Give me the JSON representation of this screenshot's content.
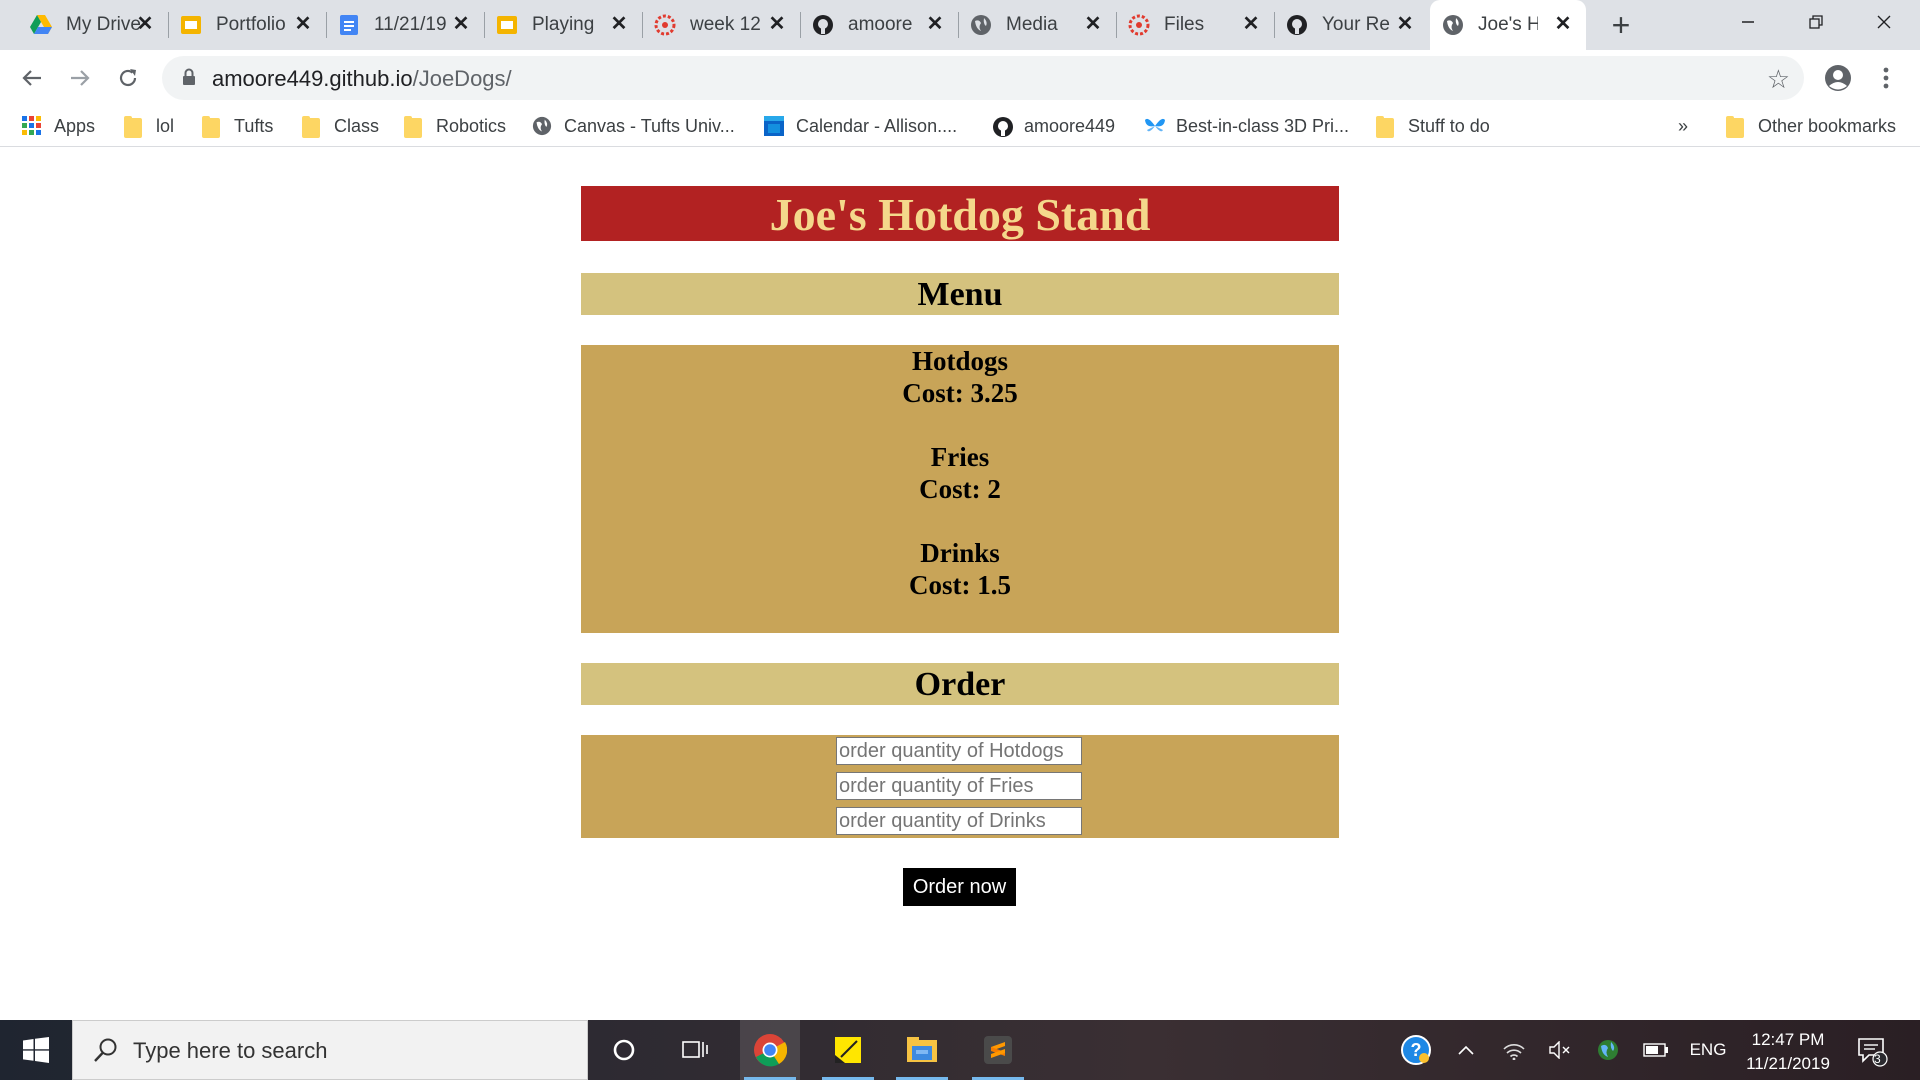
{
  "browser": {
    "tabs": [
      {
        "title": "My Drive",
        "favicon": "google-drive-icon"
      },
      {
        "title": "Portfolio",
        "favicon": "slides-icon"
      },
      {
        "title": "11/21/19",
        "favicon": "docs-icon"
      },
      {
        "title": "Playing",
        "favicon": "slides-icon"
      },
      {
        "title": "week 12",
        "favicon": "canvas-icon"
      },
      {
        "title": "amoore",
        "favicon": "github-icon"
      },
      {
        "title": "Media",
        "favicon": "globe-icon"
      },
      {
        "title": "Files",
        "favicon": "canvas-icon"
      },
      {
        "title": "Your Re",
        "favicon": "github-icon"
      },
      {
        "title": "Joe's H",
        "favicon": "globe-icon",
        "active": true
      }
    ],
    "url_host": "amoore449.github.io",
    "url_path": "/JoeDogs/",
    "bookmarks": [
      {
        "label": "Apps",
        "icon": "apps-grid-icon"
      },
      {
        "label": "lol",
        "icon": "folder-icon"
      },
      {
        "label": "Tufts",
        "icon": "folder-icon"
      },
      {
        "label": "Class",
        "icon": "folder-icon"
      },
      {
        "label": "Robotics",
        "icon": "folder-icon"
      },
      {
        "label": "Canvas - Tufts Univ...",
        "icon": "globe-icon"
      },
      {
        "label": "Calendar - Allison....",
        "icon": "calendar-icon"
      },
      {
        "label": "amoore449",
        "icon": "github-icon"
      },
      {
        "label": "Best-in-class 3D Pri...",
        "icon": "butterfly-icon"
      },
      {
        "label": "Stuff to do",
        "icon": "folder-icon"
      }
    ],
    "overflow_label": "»",
    "other_bookmarks": "Other bookmarks"
  },
  "page": {
    "title": "Joe's Hotdog Stand",
    "menu_heading": "Menu",
    "menu_items": [
      {
        "name": "Hotdogs",
        "cost": "Cost: 3.25"
      },
      {
        "name": "Fries",
        "cost": "Cost: 2"
      },
      {
        "name": "Drinks",
        "cost": "Cost: 1.5"
      }
    ],
    "order_heading": "Order",
    "order_inputs": [
      {
        "placeholder": "order quantity of Hotdogs"
      },
      {
        "placeholder": "order quantity of Fries"
      },
      {
        "placeholder": "order quantity of Drinks"
      }
    ],
    "order_button": "Order now"
  },
  "taskbar": {
    "search_placeholder": "Type here to search",
    "language": "ENG",
    "time": "12:47 PM",
    "date": "11/21/2019",
    "notification_count": "3"
  },
  "colors": {
    "header_bg": "#b22222",
    "header_text": "#f4d88b",
    "section_head_bg": "#d4c27e",
    "box_bg": "#c8a458"
  }
}
